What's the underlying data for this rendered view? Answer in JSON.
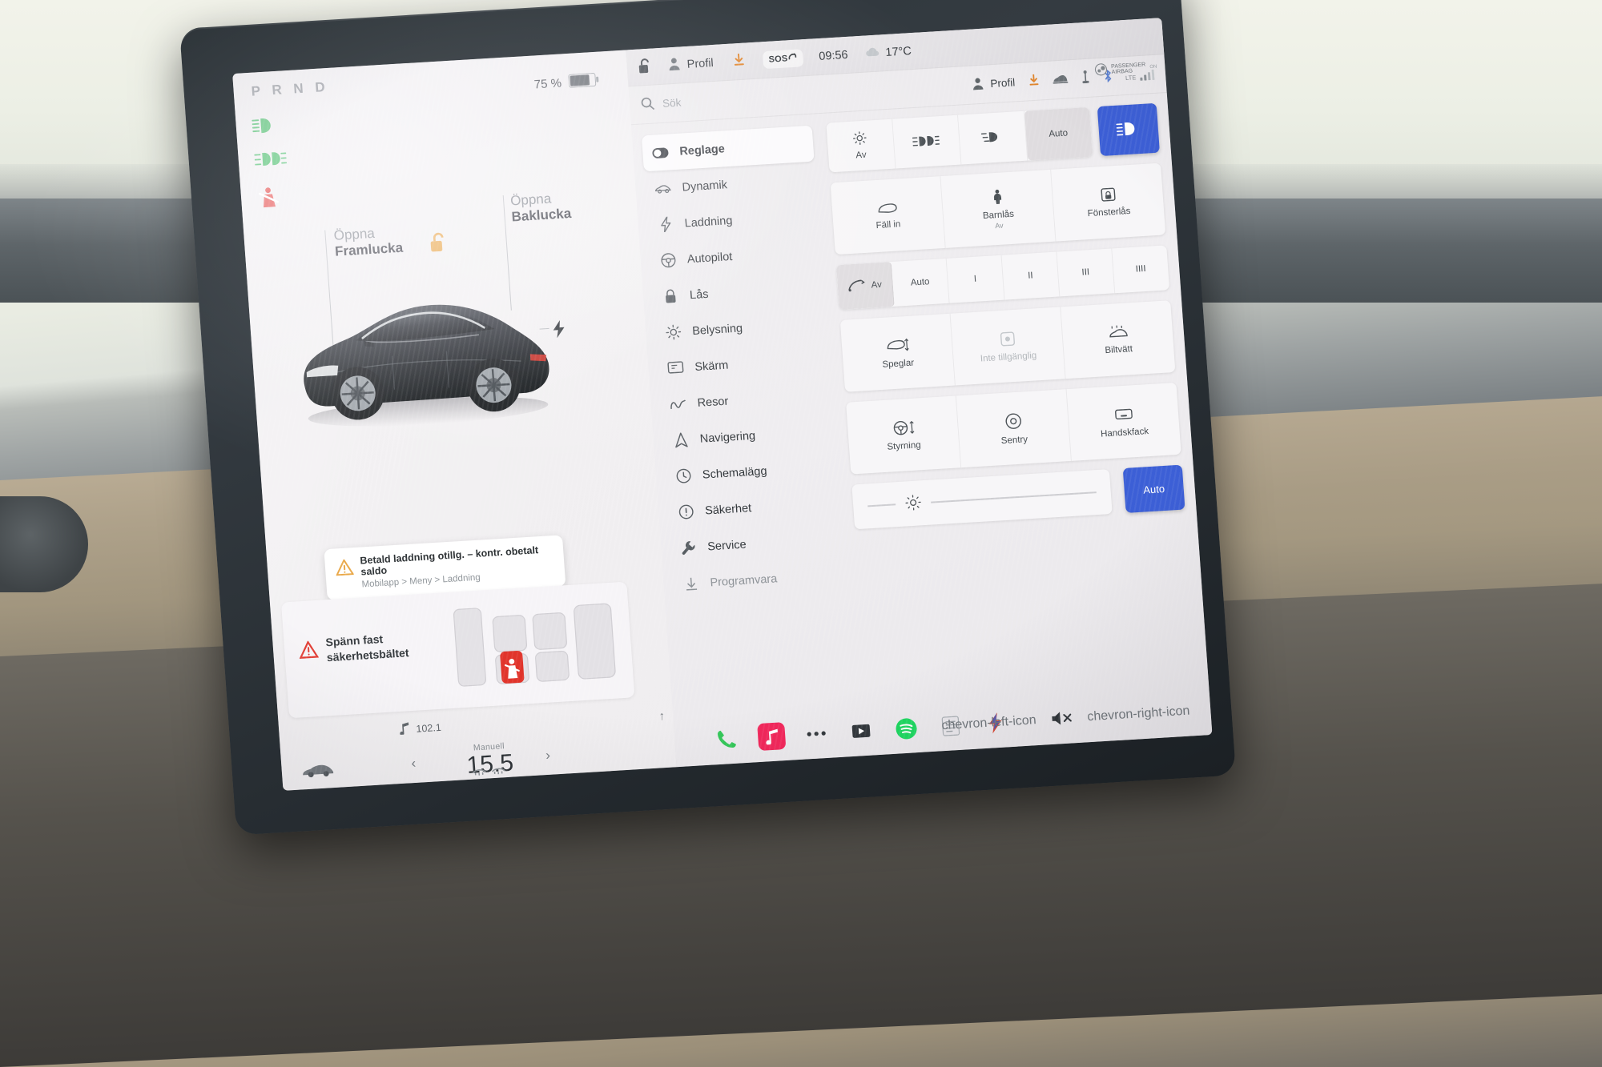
{
  "drive": {
    "prnd": "P R N D",
    "battery_percent": "75 %",
    "telltales": [
      {
        "name": "high-beam-icon",
        "color": "#25b14b"
      },
      {
        "name": "fog-light-icon",
        "color": "#25b14b"
      },
      {
        "name": "seatbelt-warning-icon",
        "color": "#e03027"
      }
    ],
    "frunk_label_1": "Öppna",
    "frunk_label_2": "Framlucka",
    "trunk_label_1": "Öppna",
    "trunk_label_2": "Baklucka",
    "alert": {
      "title": "Betald laddning otillg. – kontr. obetalt saldo",
      "subtitle": "Mobilapp > Meny > Laddning"
    },
    "belt_warning_line1": "Spänn fast",
    "belt_warning_line2": "säkerhetsbältet",
    "radio_freq": "102.1",
    "climate": {
      "mode": "Manuell",
      "temperature": "15.5",
      "left_arrow": "‹",
      "right_arrow": "›"
    }
  },
  "statusbar": {
    "lock_icon": "unlocked-padlock-icon",
    "profile": "Profil",
    "download_icon": "software-update-download-icon",
    "sos": "SOS",
    "time": "09:56",
    "outside_temp": "17°C"
  },
  "search": {
    "placeholder": "Sök",
    "profile": "Profil",
    "icons": [
      "software-update-download-icon",
      "car-connected-icon",
      "usb-icon",
      "bluetooth-icon",
      "lte-signal-icon"
    ],
    "lte_label": "LTE"
  },
  "airbag": {
    "line1": "PASSENGER",
    "line2": "AIRBAG",
    "status": "ON"
  },
  "menu": {
    "items": [
      {
        "label": "Reglage",
        "icon": "toggle-icon",
        "active": true
      },
      {
        "label": "Dynamik",
        "icon": "car-icon",
        "active": false
      },
      {
        "label": "Laddning",
        "icon": "bolt-icon",
        "active": false
      },
      {
        "label": "Autopilot",
        "icon": "steering-icon",
        "active": false
      },
      {
        "label": "Lås",
        "icon": "lock-icon",
        "active": false
      },
      {
        "label": "Belysning",
        "icon": "sun-icon",
        "active": false
      },
      {
        "label": "Skärm",
        "icon": "display-icon",
        "active": false
      },
      {
        "label": "Resor",
        "icon": "trip-icon",
        "active": false
      },
      {
        "label": "Navigering",
        "icon": "navigation-icon",
        "active": false
      },
      {
        "label": "Schemalägg",
        "icon": "clock-icon",
        "active": false
      },
      {
        "label": "Säkerhet",
        "icon": "shield-alert-icon",
        "active": false
      },
      {
        "label": "Service",
        "icon": "wrench-icon",
        "active": false
      },
      {
        "label": "Programvara",
        "icon": "download-icon",
        "active": false,
        "dim": true
      }
    ]
  },
  "tiles": {
    "lights_row": [
      {
        "label": "Av",
        "icon": "sun-brightness-icon",
        "state": "off"
      },
      {
        "label": "",
        "icon": "fog-light-icon",
        "state": "off"
      },
      {
        "label": "",
        "icon": "low-beam-icon",
        "state": "off"
      },
      {
        "label": "Auto",
        "icon": "",
        "state": "selected"
      }
    ],
    "lights_action": {
      "label": "",
      "icon": "headlight-beam-icon",
      "color": "#3c5fd6"
    },
    "doors_row": [
      {
        "label": "Fäll in",
        "sub": "",
        "icon": "fold-mirrors-icon"
      },
      {
        "label": "Barnlås",
        "sub": "Av",
        "icon": "child-lock-icon"
      },
      {
        "label": "Fönsterlås",
        "sub": "",
        "icon": "window-lock-icon"
      }
    ],
    "wiper_row": [
      {
        "label": "Av",
        "icon": "wiper-icon",
        "state": "selected"
      },
      {
        "label": "Auto",
        "icon": "",
        "state": "off"
      },
      {
        "label": "I",
        "icon": "",
        "state": "off"
      },
      {
        "label": "II",
        "icon": "",
        "state": "off"
      },
      {
        "label": "III",
        "icon": "",
        "state": "off"
      },
      {
        "label": "IIII",
        "icon": "",
        "state": "off"
      }
    ],
    "misc_rows": [
      [
        {
          "label": "Speglar",
          "icon": "mirror-adjust-icon",
          "disabled": false
        },
        {
          "label": "Inte tillgänglig",
          "icon": "unavailable-icon",
          "disabled": true
        },
        {
          "label": "Biltvätt",
          "icon": "car-wash-icon",
          "disabled": false
        }
      ],
      [
        {
          "label": "Styrning",
          "icon": "steering-adjust-icon",
          "disabled": false
        },
        {
          "label": "Sentry",
          "icon": "sentry-mode-icon",
          "disabled": false
        },
        {
          "label": "Handskfack",
          "icon": "glovebox-icon",
          "disabled": false
        }
      ]
    ],
    "brightness": {
      "icon": "brightness-icon",
      "auto_label": "Auto"
    }
  },
  "dock": {
    "items": [
      {
        "name": "phone-icon",
        "color": "#34c759"
      },
      {
        "name": "music-icon",
        "color": "#f1275b"
      },
      {
        "name": "more-icon",
        "color": "#32373b"
      },
      {
        "name": "media-icon",
        "color": "#32373b"
      },
      {
        "name": "spotify-icon",
        "color": "#1ed760"
      },
      {
        "name": "calendar-icon",
        "color": "#9aa0a5"
      },
      {
        "name": "toybox-icon",
        "color": "#d8442e"
      }
    ],
    "mute_icon": "volume-mute-icon",
    "prev_icon": "chevron-left-icon",
    "next_icon": "chevron-right-icon"
  }
}
